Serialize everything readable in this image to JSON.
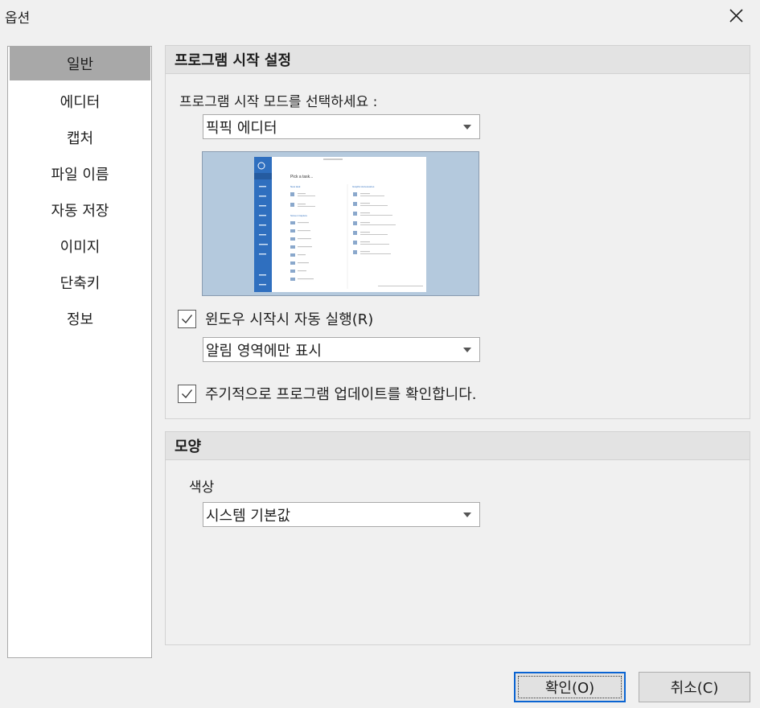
{
  "window": {
    "title": "옵션"
  },
  "sidebar": {
    "items": [
      {
        "label": "일반",
        "active": true
      },
      {
        "label": "에디터"
      },
      {
        "label": "캡처"
      },
      {
        "label": "파일 이름"
      },
      {
        "label": "자동 저장"
      },
      {
        "label": "이미지"
      },
      {
        "label": "단축키"
      },
      {
        "label": "정보"
      }
    ]
  },
  "startup": {
    "heading": "프로그램 시작 설정",
    "mode_label": "프로그램 시작 모드를 선택하세요 :",
    "mode_value": "픽픽 에디터",
    "autorun_label": "윈도우 시작시 자동 실행(R)",
    "autorun_checked": true,
    "autorun_mode_value": "알림 영역에만 표시",
    "update_label": "주기적으로 프로그램 업데이트를 확인합니다.",
    "update_checked": true,
    "preview": {
      "heading": "Pick a task...",
      "left_section": "New task",
      "middle_section": "Screen Capture",
      "right_section": "Graphic Accessories"
    }
  },
  "appearance": {
    "heading": "모양",
    "color_label": "색상",
    "color_value": "시스템 기본값"
  },
  "buttons": {
    "ok": "확인(O)",
    "cancel": "취소(C)"
  },
  "colors": {
    "accent": "#0a64d2",
    "sidebar_selected": "#a8a8a8",
    "preview_bg": "#b4c9dd",
    "preview_nav": "#2f6fbf"
  }
}
